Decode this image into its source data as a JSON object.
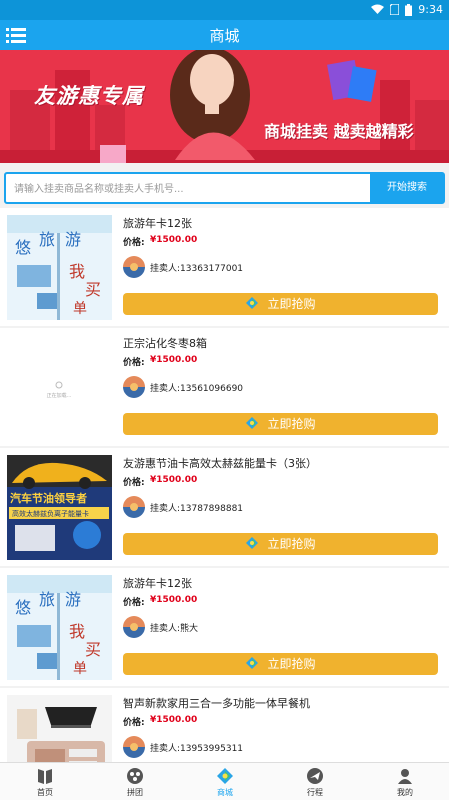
{
  "status_bar": {
    "time": "9:34"
  },
  "app_bar": {
    "title": "商城"
  },
  "banner": {
    "headline": "友游惠专属",
    "slogan": "商城挂卖 越卖越精彩"
  },
  "search": {
    "placeholder": "请输入挂卖商品名称或挂卖人手机号...",
    "button_label": "开始搜索"
  },
  "products": [
    {
      "name": "旅游年卡12张",
      "price_label": "价格:",
      "price": "¥1500.00",
      "seller": "挂卖人:13363177001",
      "buy_label": "立即抢购",
      "thumb": "travel-card"
    },
    {
      "name": "正宗沾化冬枣8箱",
      "price_label": "价格:",
      "price": "¥1500.00",
      "seller": "挂卖人:13561096690",
      "buy_label": "立即抢购",
      "thumb": "loading"
    },
    {
      "name": "友游惠节油卡高效太赫兹能量卡（3张）",
      "price_label": "价格:",
      "price": "¥1500.00",
      "seller": "挂卖人:13787898881",
      "buy_label": "立即抢购",
      "thumb": "fuel-card"
    },
    {
      "name": "旅游年卡12张",
      "price_label": "价格:",
      "price": "¥1500.00",
      "seller": "挂卖人:熊大",
      "buy_label": "立即抢购",
      "thumb": "travel-card"
    },
    {
      "name": "智声新款家用三合一多功能一体早餐机",
      "price_label": "价格:",
      "price": "¥1500.00",
      "seller": "挂卖人:13953995311",
      "buy_label": "立即抢购",
      "thumb": "breakfast-machine"
    }
  ],
  "thumb_texts": {
    "travel": [
      "悠",
      "旅",
      "游",
      "我",
      "买",
      "单"
    ],
    "fuel_title": "汽车节油领导者",
    "fuel_sub": "高效太赫兹负离子能量卡",
    "loading": "正在加载..."
  },
  "tabs": [
    {
      "label": "首页",
      "icon": "book-icon"
    },
    {
      "label": "拼团",
      "icon": "group-icon"
    },
    {
      "label": "商城",
      "icon": "mall-icon",
      "active": true
    },
    {
      "label": "行程",
      "icon": "plane-icon"
    },
    {
      "label": "我的",
      "icon": "user-icon"
    }
  ],
  "colors": {
    "primary": "#1ba4ee",
    "buy_button": "#f0b22e",
    "price": "#e0001a",
    "banner": "#e8344a"
  }
}
